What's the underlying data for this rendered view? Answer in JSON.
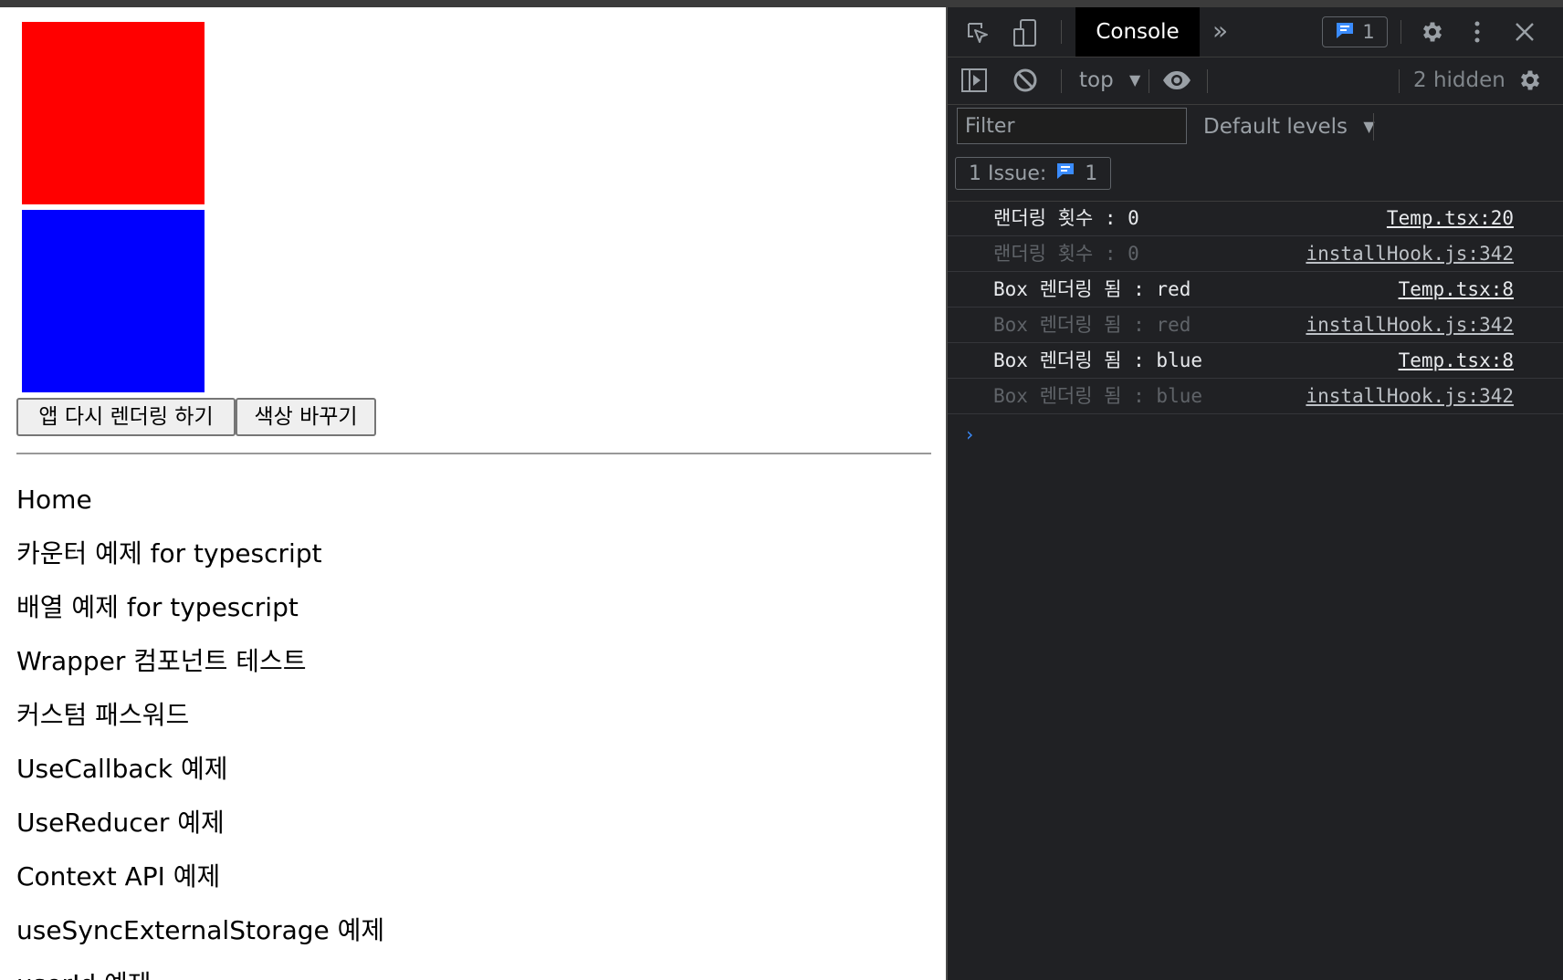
{
  "app": {
    "boxes": {
      "first_color": "#ff0000",
      "second_color": "#0000ff"
    },
    "buttons": {
      "rerender": "앱 다시 렌더링 하기",
      "change_color": "색상 바꾸기"
    },
    "nav": [
      "Home",
      "카운터 예제 for typescript",
      "배열 예제 for typescript",
      "Wrapper 컴포넌트 테스트",
      "커스텀 패스워드",
      "UseCallback 예제",
      "UseReducer 예제",
      "Context API 예제",
      "useSyncExternalStorage 예제",
      "userId 예제"
    ]
  },
  "devtools": {
    "toolbar": {
      "icons": [
        "inspect-element-icon",
        "device-toolbar-icon",
        "more-tabs-icon",
        "issues-icon",
        "settings-icon",
        "more-options-icon",
        "close-icon"
      ],
      "active_tab": "Console",
      "more_tabs": "»",
      "issues_count": "1"
    },
    "console_toolbar": {
      "context": "top",
      "hidden_messages": "2 hidden"
    },
    "filter": {
      "placeholder": "Filter",
      "levels": "Default levels"
    },
    "issues_bar": {
      "label": "1 Issue:",
      "count": "1"
    },
    "logs": [
      {
        "message": "랜더링 횟수 : 0",
        "source": "Temp.tsx:20",
        "dim": false
      },
      {
        "message": "랜더링 횟수 : 0",
        "source": "installHook.js:342",
        "dim": true
      },
      {
        "message": "Box 렌더링 됨 : red",
        "source": "Temp.tsx:8",
        "dim": false
      },
      {
        "message": "Box 렌더링 됨 : red",
        "source": "installHook.js:342",
        "dim": true
      },
      {
        "message": "Box 렌더링 됨 : blue",
        "source": "Temp.tsx:8",
        "dim": false
      },
      {
        "message": "Box 렌더링 됨 : blue",
        "source": "installHook.js:342",
        "dim": true
      }
    ],
    "prompt": "›",
    "colors": {
      "background": "#202124",
      "accent": "#3a8cff"
    }
  }
}
